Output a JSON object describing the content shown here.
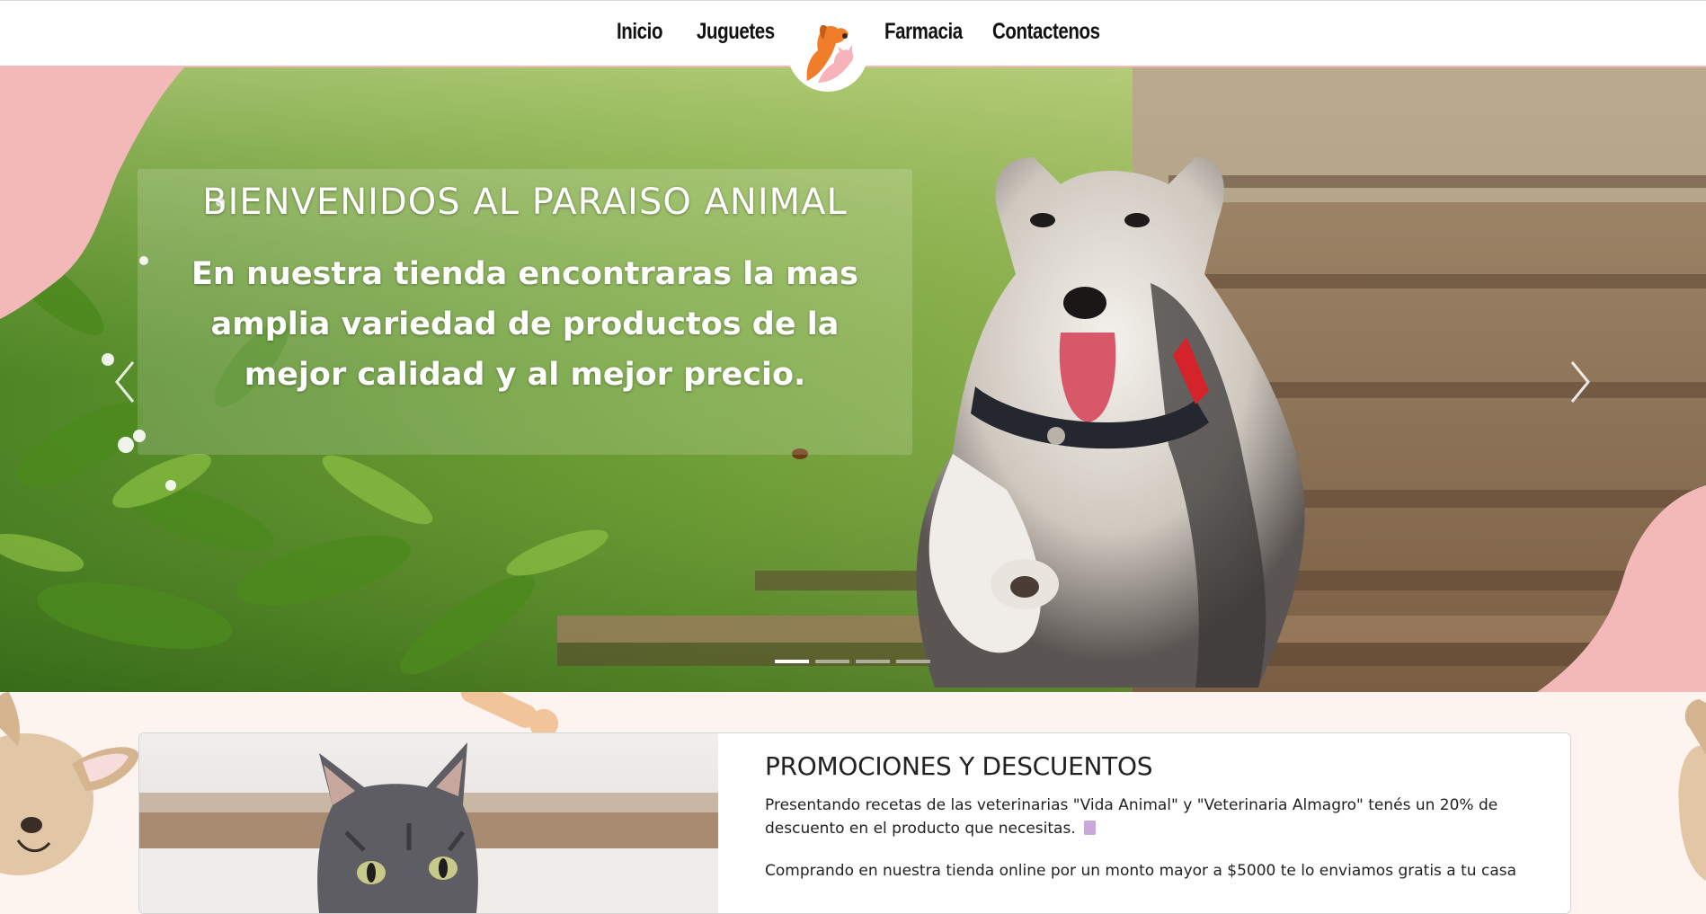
{
  "nav": {
    "items": [
      {
        "label": "Inicio"
      },
      {
        "label": "Juguetes"
      },
      {
        "label": "Farmacia"
      },
      {
        "label": "Contactenos"
      }
    ],
    "logo_icon": "dog-cat-logo-icon"
  },
  "hero": {
    "title": "BIENVENIDOS AL PARAISO ANIMAL",
    "text": "En nuestra tienda encontraras la mas amplia variedad de productos de la mejor calidad y al mejor precio.",
    "prev_icon": "chevron-left-icon",
    "next_icon": "chevron-right-icon",
    "slides_total": 4,
    "active_slide": 1
  },
  "promo": {
    "title": "PROMOCIONES Y DESCUENTOS",
    "paragraph_1": "Presentando recetas de las veterinarias \"Vida Animal\" y \"Veterinaria Almagro\" tenés un 20% de descuento en el producto que necesitas.",
    "paragraph_2": "Comprando en nuestra tienda online por un monto mayor a $5000 te lo enviamos gratis a tu casa"
  },
  "colors": {
    "accent_pink": "#f3b8b8",
    "logo_orange": "#ef7d2a",
    "logo_pink": "#f6b3b9",
    "background": "#fdf3ef"
  }
}
